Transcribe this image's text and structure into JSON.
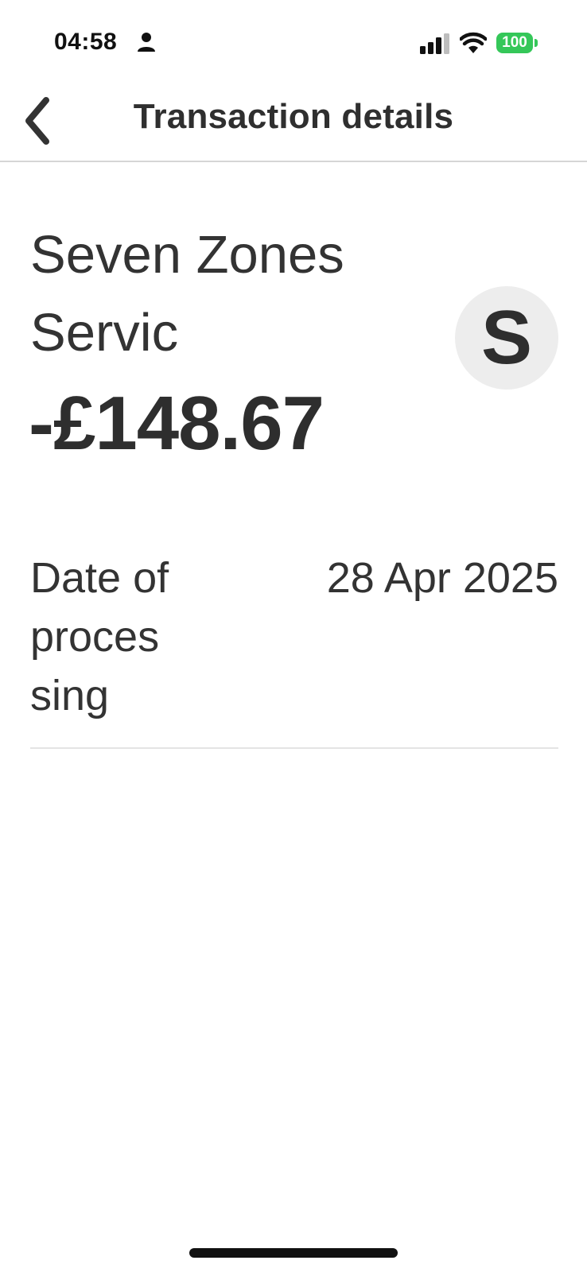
{
  "status_bar": {
    "time": "04:58",
    "battery": "100",
    "icons": [
      "person-icon",
      "signal-icon",
      "wifi-icon",
      "battery-icon"
    ],
    "battery_color": "#35c759"
  },
  "nav": {
    "title": "Transaction details",
    "back_icon": "chevron-left-icon"
  },
  "transaction": {
    "merchant_line1": "Seven Zones",
    "merchant_line2": "Servic",
    "amount": "-£148.67",
    "avatar_initial": "S"
  },
  "details": [
    {
      "label_lines": [
        "Date of",
        "proces",
        "sing"
      ],
      "value": "28 Apr 2025"
    }
  ]
}
